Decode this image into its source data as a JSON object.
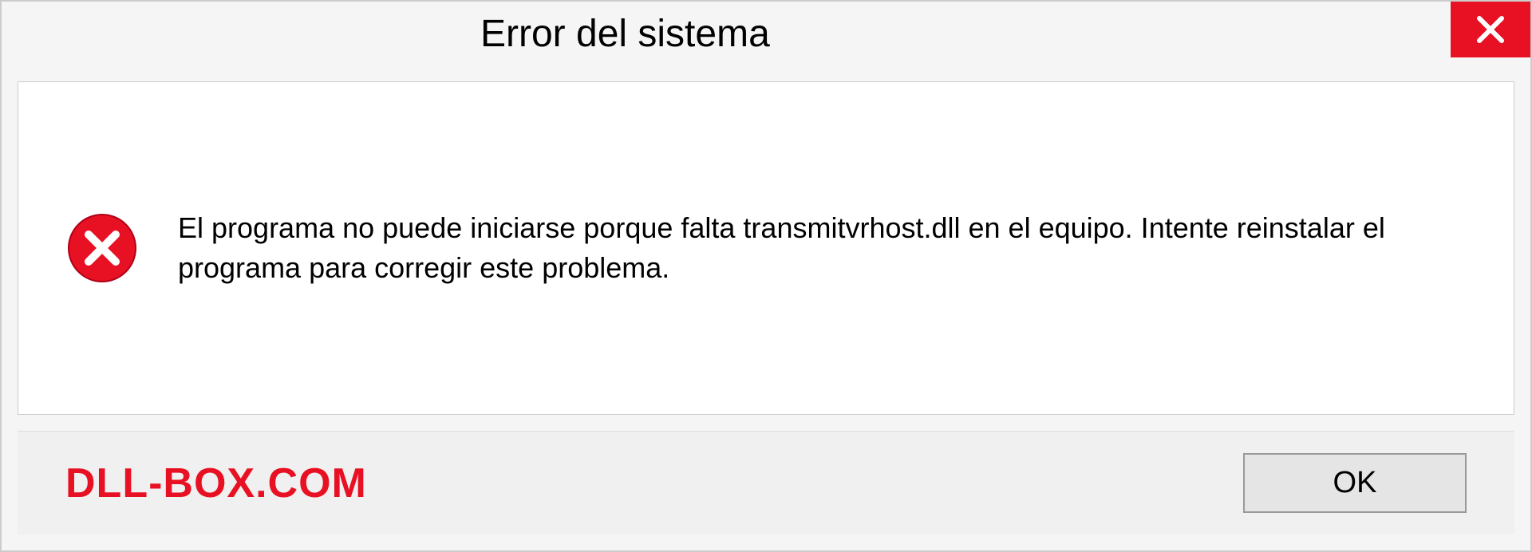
{
  "titlebar": {
    "title": "Error del sistema"
  },
  "message": {
    "text": "El programa no puede iniciarse porque falta transmitvrhost.dll en el equipo. Intente reinstalar el programa para corregir este problema."
  },
  "footer": {
    "watermark": "DLL-BOX.COM",
    "ok_label": "OK"
  },
  "colors": {
    "error_red": "#e81123",
    "dialog_bg": "#f5f5f5",
    "content_bg": "#ffffff"
  }
}
